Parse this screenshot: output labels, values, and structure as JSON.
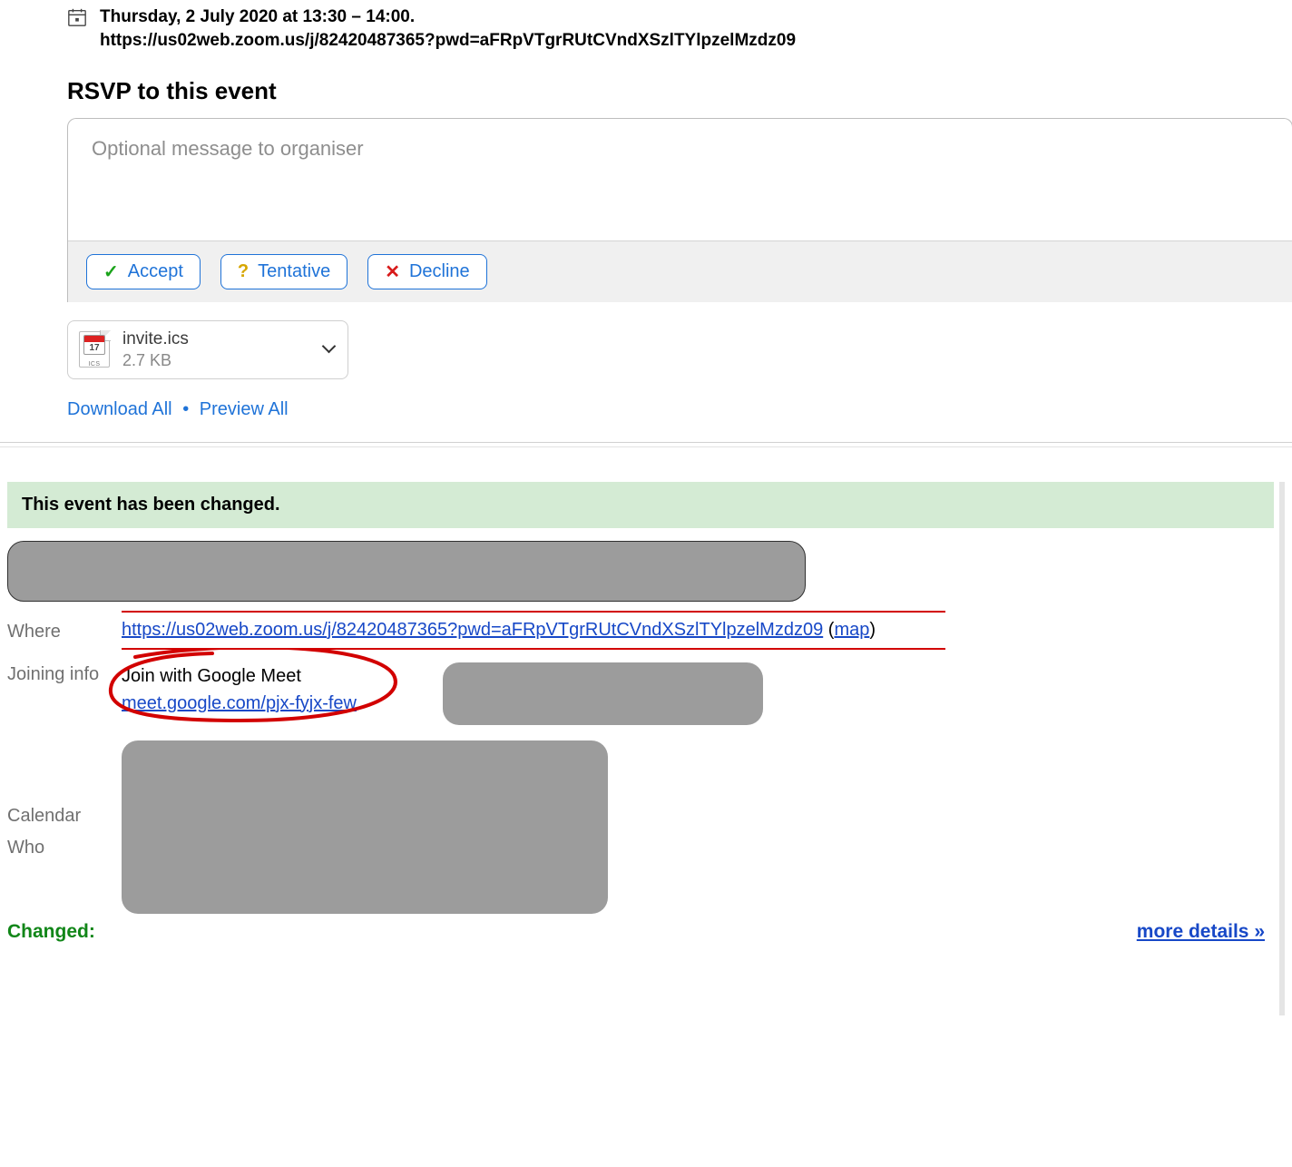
{
  "event": {
    "datetime_line": "Thursday, 2 July 2020 at 13:30 – 14:00.",
    "zoom_url_line": "https://us02web.zoom.us/j/82420487365?pwd=aFRpVTgrRUtCVndXSzlTYlpzelMzdz09"
  },
  "rsvp": {
    "title": "RSVP to this event",
    "message_placeholder": "Optional message to organiser",
    "accept_label": "Accept",
    "tentative_label": "Tentative",
    "decline_label": "Decline"
  },
  "attachment": {
    "name": "invite.ics",
    "size": "2.7 KB",
    "cal_day": "17",
    "cal_ext": "ICS"
  },
  "links": {
    "download_all": "Download All",
    "preview_all": "Preview All"
  },
  "banner": "This event has been changed.",
  "details": {
    "where_label": "Where",
    "where_link": "https://us02web.zoom.us/j/82420487365?pwd=aFRpVTgrRUtCVndXSzlTYlpzelMzdz09",
    "map_text": "map",
    "joining_label": "Joining info",
    "join_title": "Join with Google Meet",
    "join_link": "meet.google.com/pjx-fyjx-few",
    "calendar_label": "Calendar",
    "who_label": "Who",
    "changed_label": "Changed:",
    "more_details": "more details »"
  }
}
